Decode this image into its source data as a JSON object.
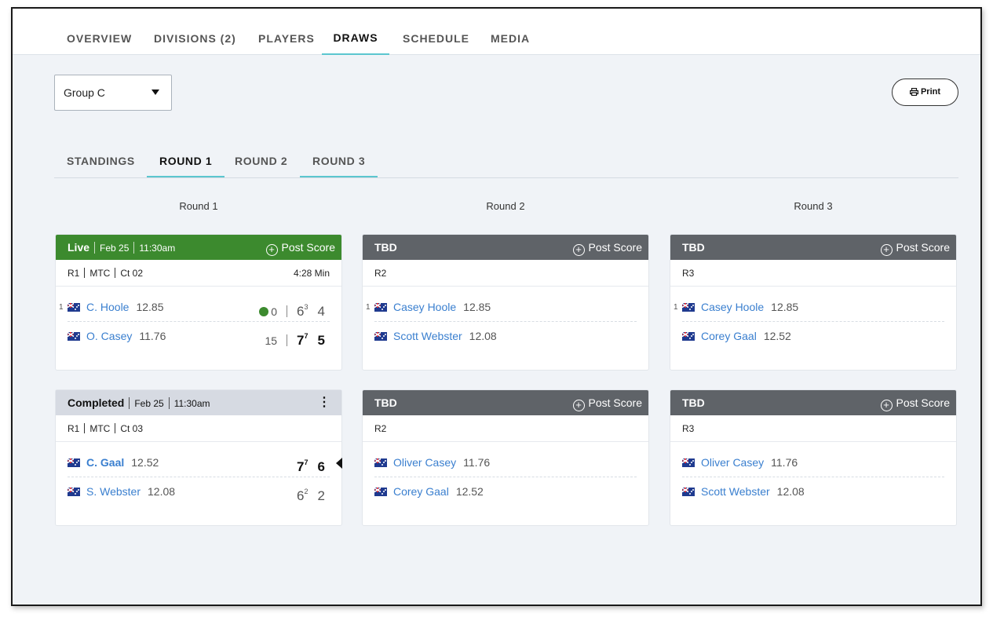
{
  "nav": {
    "tabs": [
      {
        "label": "OVERVIEW"
      },
      {
        "label": "DIVISIONS (2)"
      },
      {
        "label": "PLAYERS"
      },
      {
        "label": "DRAWS"
      },
      {
        "label": "SCHEDULE"
      },
      {
        "label": "MEDIA"
      }
    ],
    "active": "DRAWS"
  },
  "group_select": {
    "value": "Group C"
  },
  "print_label": "Print",
  "subtabs": [
    {
      "label": "STANDINGS"
    },
    {
      "label": "ROUND 1"
    },
    {
      "label": "ROUND 2"
    },
    {
      "label": "ROUND 3"
    }
  ],
  "columns": [
    "Round 1",
    "Round 2",
    "Round 3"
  ],
  "post_score_label": "Post Score",
  "matches": [
    {
      "status": "Live",
      "date": "Feb 25",
      "time": "11:30am",
      "timer": "4:28 Min",
      "round": "R1",
      "venue": "MTC",
      "court": "Ct 02",
      "p1": {
        "seed": "1",
        "name": "C. Hoole",
        "rating": "12.85",
        "pts": "0",
        "set1": "6",
        "set1_tb": "3",
        "set2": "4"
      },
      "p2": {
        "name": "O. Casey",
        "rating": "11.76",
        "pts": "15",
        "set1": "7",
        "set1_tb": "7",
        "set2": "5"
      }
    },
    {
      "status": "TBD",
      "round": "R2",
      "p1": {
        "seed": "1",
        "name": "Casey Hoole",
        "rating": "12.85"
      },
      "p2": {
        "name": "Scott Webster",
        "rating": "12.08"
      }
    },
    {
      "status": "TBD",
      "round": "R3",
      "p1": {
        "seed": "1",
        "name": "Casey Hoole",
        "rating": "12.85"
      },
      "p2": {
        "name": "Corey Gaal",
        "rating": "12.52"
      }
    },
    {
      "status": "Completed",
      "date": "Feb 25",
      "time": "11:30am",
      "round": "R1",
      "venue": "MTC",
      "court": "Ct 03",
      "p1": {
        "name": "C. Gaal",
        "rating": "12.52",
        "set1": "7",
        "set1_tb": "7",
        "set2": "6"
      },
      "p2": {
        "name": "S. Webster",
        "rating": "12.08",
        "set1": "6",
        "set1_tb": "2",
        "set2": "2"
      }
    },
    {
      "status": "TBD",
      "round": "R2",
      "p1": {
        "name": "Oliver Casey",
        "rating": "11.76"
      },
      "p2": {
        "name": "Corey Gaal",
        "rating": "12.52"
      }
    },
    {
      "status": "TBD",
      "round": "R3",
      "p1": {
        "name": "Oliver Casey",
        "rating": "11.76"
      },
      "p2": {
        "name": "Scott Webster",
        "rating": "12.08"
      }
    }
  ],
  "colors": {
    "live": "#3c8a2e",
    "tbd": "#5f6368",
    "completed": "#d6dae2",
    "accent": "#5bc6cf",
    "link": "#3a7fcf"
  }
}
